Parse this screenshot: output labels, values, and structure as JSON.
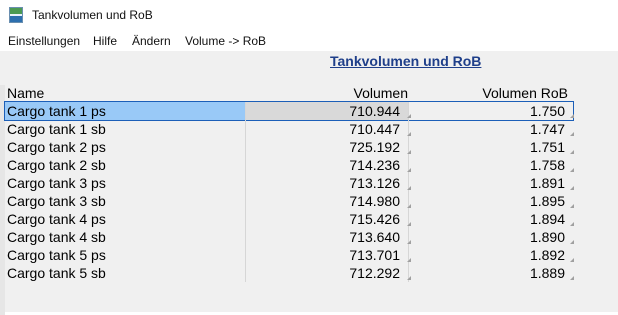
{
  "window": {
    "title": "Tankvolumen und RoB"
  },
  "menu": {
    "items": [
      "Einstellungen",
      "Hilfe",
      "Ändern",
      "Volume -> RoB"
    ]
  },
  "report": {
    "title": "Tankvolumen und RoB"
  },
  "table": {
    "columns": [
      "Name",
      "Volumen",
      "Volumen RoB"
    ],
    "rows": [
      {
        "name": "Cargo tank 1 ps",
        "volume": "710.944",
        "rob": "1.750"
      },
      {
        "name": "Cargo tank 1 sb",
        "volume": "710.447",
        "rob": "1.747"
      },
      {
        "name": "Cargo tank 2 ps",
        "volume": "725.192",
        "rob": "1.751"
      },
      {
        "name": "Cargo tank 2 sb",
        "volume": "714.236",
        "rob": "1.758"
      },
      {
        "name": "Cargo tank 3 ps",
        "volume": "713.126",
        "rob": "1.891"
      },
      {
        "name": "Cargo tank 3 sb",
        "volume": "714.980",
        "rob": "1.895"
      },
      {
        "name": "Cargo tank 4 ps",
        "volume": "715.426",
        "rob": "1.894"
      },
      {
        "name": "Cargo tank 4 sb",
        "volume": "713.640",
        "rob": "1.890"
      },
      {
        "name": "Cargo tank 5 ps",
        "volume": "713.701",
        "rob": "1.892"
      },
      {
        "name": "Cargo tank 5 sb",
        "volume": "712.292",
        "rob": "1.889"
      }
    ]
  }
}
